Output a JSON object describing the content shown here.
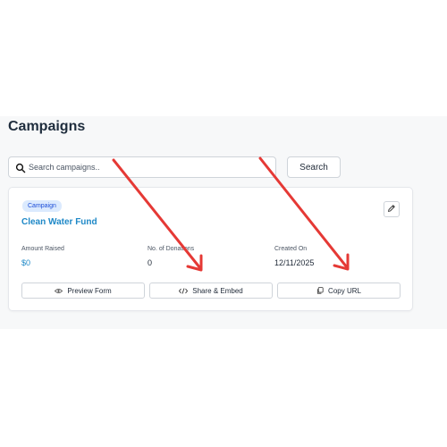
{
  "page": {
    "title": "Campaigns"
  },
  "search": {
    "placeholder": "Search campaigns..",
    "button_label": "Search"
  },
  "campaign_card": {
    "badge": "Campaign",
    "name": "Clean Water Fund",
    "stats": [
      {
        "label": "Amount Raised",
        "value": "$0"
      },
      {
        "label": "No. of Donations",
        "value": "0"
      },
      {
        "label": "Created On",
        "value": "12/11/2025"
      }
    ],
    "actions": [
      {
        "label": "Preview Form",
        "icon": "eye-icon"
      },
      {
        "label": "Share & Embed",
        "icon": "code-icon"
      },
      {
        "label": "Copy URL",
        "icon": "copy-icon"
      }
    ]
  },
  "colors": {
    "accent": "#1e88c7",
    "badge_bg": "#dbeafe",
    "annotation_arrow": "#e53935"
  }
}
